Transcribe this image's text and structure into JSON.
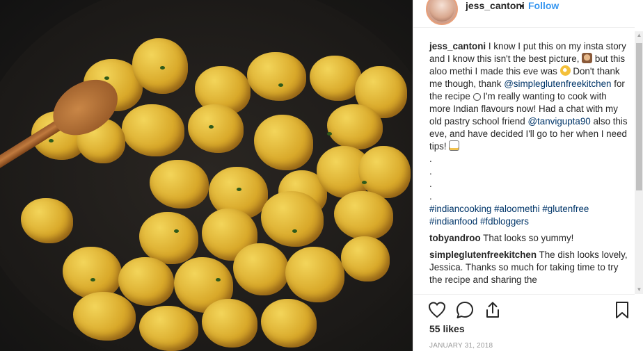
{
  "header": {
    "username": "jess_cantoni",
    "separator": "•",
    "follow_label": "Follow"
  },
  "caption": {
    "username": "jess_cantoni",
    "text_1": "I know I put this on my insta story and I know this isn't the best picture,",
    "text_2": "but this aloo methi I made this eve was",
    "text_3": "Don't thank me though, thank",
    "mention_1": "@simpleglutenfreekitchen",
    "text_4": "for the recipe",
    "text_5": "I'm really wanting to cook with more Indian flavours now! Had a chat with my old pastry school friend",
    "mention_2": "@tanvigupta90",
    "text_6": "also this eve, and have decided I'll go to her when I need tips!",
    "dot": ".",
    "hashtags": [
      "#indiancooking",
      "#aloomethi",
      "#glutenfree",
      "#indianfood",
      "#fdbloggers"
    ]
  },
  "comments": [
    {
      "username": "tobyandroo",
      "text": "That looks so yummy!"
    },
    {
      "username": "simpleglutenfreekitchen",
      "text": "The dish looks lovely, Jessica. Thanks so much for taking time to try the recipe and sharing the"
    }
  ],
  "icons": [
    "heart-icon",
    "comment-icon",
    "share-icon",
    "bookmark-icon",
    "see-no-evil-monkey-emoji",
    "ok-hand-emoji",
    "smile-emoji",
    "memo-emoji"
  ],
  "likes": "55 likes",
  "date": "JANUARY 31, 2018",
  "colors": {
    "link": "#003569",
    "follow": "#3897f0",
    "text": "#262626",
    "muted": "#999999"
  }
}
